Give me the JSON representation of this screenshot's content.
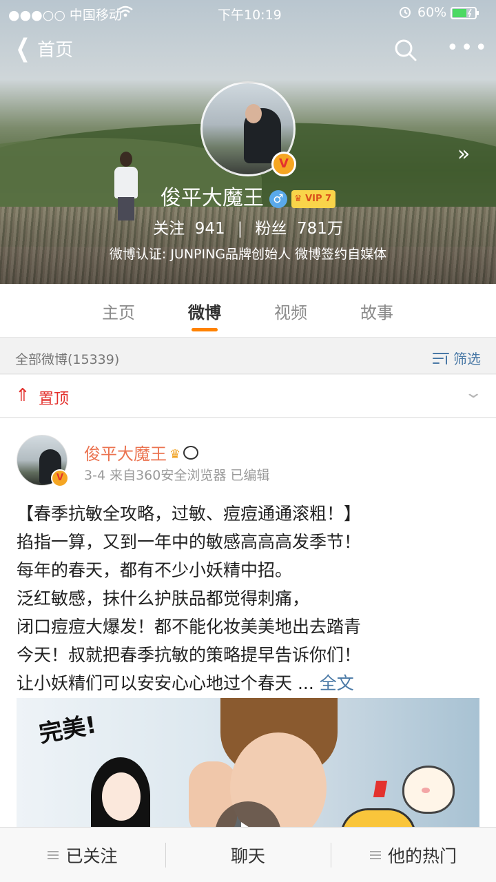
{
  "status_bar": {
    "carrier": "●●●○○ 中国移动",
    "time": "下午10:19",
    "battery": "60%"
  },
  "nav": {
    "back_label": "首页"
  },
  "profile": {
    "username": "俊平大魔王",
    "gender_symbol": "♂",
    "vip_badge": "VIP 7",
    "verified_badge": "V",
    "following_label": "关注",
    "following_count": "941",
    "followers_label": "粉丝",
    "followers_count": "781万",
    "verification": "微博认证: JUNPING品牌创始人 微博签约自媒体"
  },
  "tabs": [
    {
      "label": "主页",
      "active": false
    },
    {
      "label": "微博",
      "active": true
    },
    {
      "label": "视频",
      "active": false
    },
    {
      "label": "故事",
      "active": false
    }
  ],
  "filter_bar": {
    "all_label": "全部微博(15339)",
    "filter_label": "筛选"
  },
  "pinned": {
    "label": "置顶"
  },
  "post": {
    "author": "俊平大魔王",
    "meta": "3-4  来自360安全浏览器  已编辑",
    "lines": [
      "【春季抗敏全攻略，过敏、痘痘通通滚粗！】",
      "掐指一算，又到一年中的敏感高高高发季节！",
      "每年的春天，都有不少小妖精中招。",
      "泛红敏感，抹什么护肤品都觉得刺痛，",
      "闭口痘痘大爆发！都不能化妆美美地出去踏青",
      "今天！叔就把春季抗敏的策略提早告诉你们！",
      "让小妖精们可以安安心心地过个春天 ..."
    ],
    "more_label": "全文",
    "media_sticker_text": "完美!"
  },
  "bottom_bar": {
    "followed_label": "已关注",
    "chat_label": "聊天",
    "hot_label": "他的热门"
  },
  "colors": {
    "accent_orange": "#ff8200",
    "name_orange": "#eb7350",
    "link_blue": "#4a79a6",
    "pin_red": "#e3322e"
  }
}
